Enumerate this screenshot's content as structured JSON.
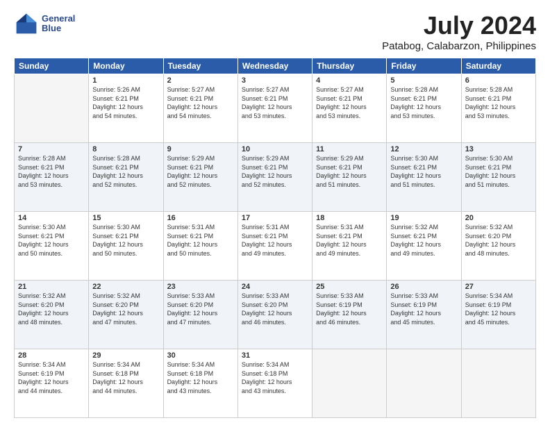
{
  "header": {
    "logo_line1": "General",
    "logo_line2": "Blue",
    "title": "July 2024",
    "subtitle": "Patabog, Calabarzon, Philippines"
  },
  "columns": [
    "Sunday",
    "Monday",
    "Tuesday",
    "Wednesday",
    "Thursday",
    "Friday",
    "Saturday"
  ],
  "weeks": [
    [
      {
        "day": "",
        "info": ""
      },
      {
        "day": "1",
        "info": "Sunrise: 5:26 AM\nSunset: 6:21 PM\nDaylight: 12 hours\nand 54 minutes."
      },
      {
        "day": "2",
        "info": "Sunrise: 5:27 AM\nSunset: 6:21 PM\nDaylight: 12 hours\nand 54 minutes."
      },
      {
        "day": "3",
        "info": "Sunrise: 5:27 AM\nSunset: 6:21 PM\nDaylight: 12 hours\nand 53 minutes."
      },
      {
        "day": "4",
        "info": "Sunrise: 5:27 AM\nSunset: 6:21 PM\nDaylight: 12 hours\nand 53 minutes."
      },
      {
        "day": "5",
        "info": "Sunrise: 5:28 AM\nSunset: 6:21 PM\nDaylight: 12 hours\nand 53 minutes."
      },
      {
        "day": "6",
        "info": "Sunrise: 5:28 AM\nSunset: 6:21 PM\nDaylight: 12 hours\nand 53 minutes."
      }
    ],
    [
      {
        "day": "7",
        "info": "Sunrise: 5:28 AM\nSunset: 6:21 PM\nDaylight: 12 hours\nand 53 minutes."
      },
      {
        "day": "8",
        "info": "Sunrise: 5:28 AM\nSunset: 6:21 PM\nDaylight: 12 hours\nand 52 minutes."
      },
      {
        "day": "9",
        "info": "Sunrise: 5:29 AM\nSunset: 6:21 PM\nDaylight: 12 hours\nand 52 minutes."
      },
      {
        "day": "10",
        "info": "Sunrise: 5:29 AM\nSunset: 6:21 PM\nDaylight: 12 hours\nand 52 minutes."
      },
      {
        "day": "11",
        "info": "Sunrise: 5:29 AM\nSunset: 6:21 PM\nDaylight: 12 hours\nand 51 minutes."
      },
      {
        "day": "12",
        "info": "Sunrise: 5:30 AM\nSunset: 6:21 PM\nDaylight: 12 hours\nand 51 minutes."
      },
      {
        "day": "13",
        "info": "Sunrise: 5:30 AM\nSunset: 6:21 PM\nDaylight: 12 hours\nand 51 minutes."
      }
    ],
    [
      {
        "day": "14",
        "info": "Sunrise: 5:30 AM\nSunset: 6:21 PM\nDaylight: 12 hours\nand 50 minutes."
      },
      {
        "day": "15",
        "info": "Sunrise: 5:30 AM\nSunset: 6:21 PM\nDaylight: 12 hours\nand 50 minutes."
      },
      {
        "day": "16",
        "info": "Sunrise: 5:31 AM\nSunset: 6:21 PM\nDaylight: 12 hours\nand 50 minutes."
      },
      {
        "day": "17",
        "info": "Sunrise: 5:31 AM\nSunset: 6:21 PM\nDaylight: 12 hours\nand 49 minutes."
      },
      {
        "day": "18",
        "info": "Sunrise: 5:31 AM\nSunset: 6:21 PM\nDaylight: 12 hours\nand 49 minutes."
      },
      {
        "day": "19",
        "info": "Sunrise: 5:32 AM\nSunset: 6:21 PM\nDaylight: 12 hours\nand 49 minutes."
      },
      {
        "day": "20",
        "info": "Sunrise: 5:32 AM\nSunset: 6:20 PM\nDaylight: 12 hours\nand 48 minutes."
      }
    ],
    [
      {
        "day": "21",
        "info": "Sunrise: 5:32 AM\nSunset: 6:20 PM\nDaylight: 12 hours\nand 48 minutes."
      },
      {
        "day": "22",
        "info": "Sunrise: 5:32 AM\nSunset: 6:20 PM\nDaylight: 12 hours\nand 47 minutes."
      },
      {
        "day": "23",
        "info": "Sunrise: 5:33 AM\nSunset: 6:20 PM\nDaylight: 12 hours\nand 47 minutes."
      },
      {
        "day": "24",
        "info": "Sunrise: 5:33 AM\nSunset: 6:20 PM\nDaylight: 12 hours\nand 46 minutes."
      },
      {
        "day": "25",
        "info": "Sunrise: 5:33 AM\nSunset: 6:19 PM\nDaylight: 12 hours\nand 46 minutes."
      },
      {
        "day": "26",
        "info": "Sunrise: 5:33 AM\nSunset: 6:19 PM\nDaylight: 12 hours\nand 45 minutes."
      },
      {
        "day": "27",
        "info": "Sunrise: 5:34 AM\nSunset: 6:19 PM\nDaylight: 12 hours\nand 45 minutes."
      }
    ],
    [
      {
        "day": "28",
        "info": "Sunrise: 5:34 AM\nSunset: 6:19 PM\nDaylight: 12 hours\nand 44 minutes."
      },
      {
        "day": "29",
        "info": "Sunrise: 5:34 AM\nSunset: 6:18 PM\nDaylight: 12 hours\nand 44 minutes."
      },
      {
        "day": "30",
        "info": "Sunrise: 5:34 AM\nSunset: 6:18 PM\nDaylight: 12 hours\nand 43 minutes."
      },
      {
        "day": "31",
        "info": "Sunrise: 5:34 AM\nSunset: 6:18 PM\nDaylight: 12 hours\nand 43 minutes."
      },
      {
        "day": "",
        "info": ""
      },
      {
        "day": "",
        "info": ""
      },
      {
        "day": "",
        "info": ""
      }
    ]
  ]
}
